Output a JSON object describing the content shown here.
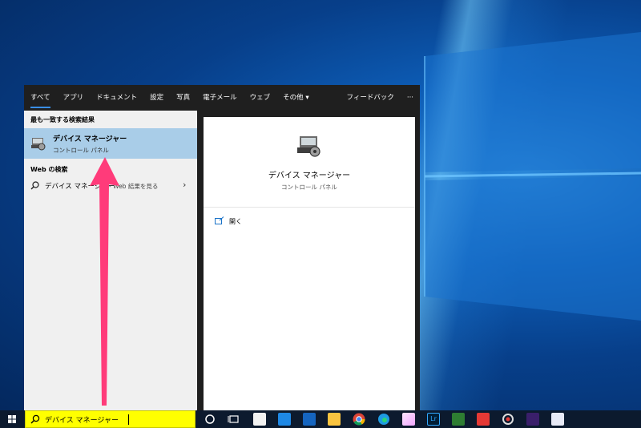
{
  "tabs": [
    "すべて",
    "アプリ",
    "ドキュメント",
    "設定",
    "写真",
    "電子メール",
    "ウェブ",
    "その他"
  ],
  "tabs_right": {
    "feedback": "フィードバック",
    "more": "···"
  },
  "left": {
    "best_match_header": "最も一致する検索結果",
    "best_match": {
      "title": "デバイス マネージャー",
      "subtitle": "コントロール パネル"
    },
    "web_header": "Web の検索",
    "web_query": "デバイス マネージャー",
    "web_suffix": "- Web 結果を見る"
  },
  "preview": {
    "title": "デバイス マネージャー",
    "subtitle": "コントロール パネル",
    "open_label": "開く"
  },
  "taskbar": {
    "search_text": "デバイス マネージャー"
  },
  "icons": [
    "windows-start-icon",
    "search-icon",
    "cortana-icon",
    "task-view-icon",
    "store-icon",
    "photos-icon",
    "mail-icon",
    "explorer-icon",
    "chrome-icon",
    "edge-icon",
    "app-icon",
    "lightroom-icon",
    "app-icon",
    "app-icon",
    "app-icon",
    "amazon-music-icon",
    "app-icon"
  ],
  "colors": {
    "accent": "#3a8ee6",
    "selection": "#a9cde8",
    "search_highlight": "#ffff00",
    "arrow": "#ff3b7a"
  }
}
